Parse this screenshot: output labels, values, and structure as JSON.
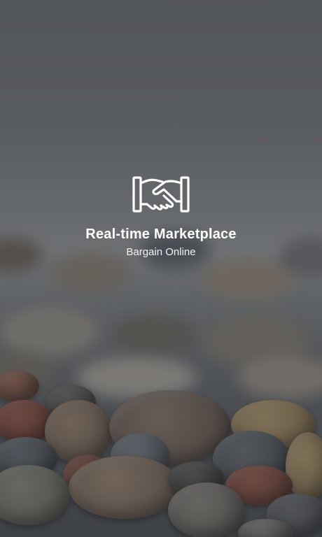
{
  "splash": {
    "logo_icon": "handshake-icon",
    "title": "Real-time Marketplace",
    "subtitle": "Bargain Online"
  },
  "colors": {
    "text": "#ffffff",
    "overlay": "#2a2c30"
  }
}
